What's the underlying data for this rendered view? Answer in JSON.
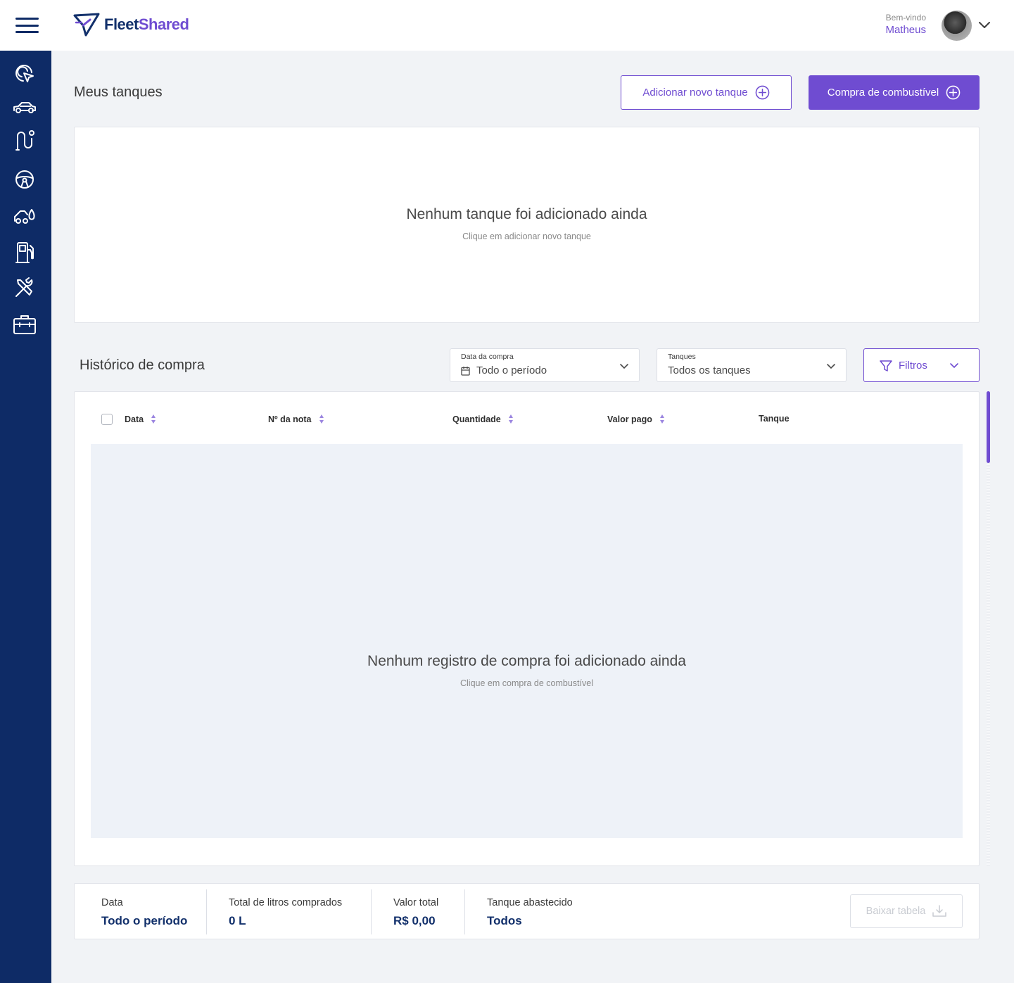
{
  "header": {
    "logo_fleet": "Fleet",
    "logo_shared": "Shared",
    "welcome_label": "Bem-vindo",
    "user_name": "Matheus"
  },
  "sidebar": {
    "items": [
      {
        "icon": "cursor-target-icon"
      },
      {
        "icon": "car-icon"
      },
      {
        "icon": "route-icon"
      },
      {
        "icon": "steering-wheel-icon"
      },
      {
        "icon": "car-fuel-drop-icon"
      },
      {
        "icon": "fuel-pump-icon"
      },
      {
        "icon": "tools-icon"
      },
      {
        "icon": "briefcase-icon"
      }
    ]
  },
  "tanks": {
    "title": "Meus tanques",
    "add_button": "Adicionar novo tanque",
    "purchase_button": "Compra de combustível",
    "empty_title": "Nenhum tanque foi adicionado ainda",
    "empty_subtitle": "Clique em adicionar novo tanque"
  },
  "history": {
    "title": "Histórico de compra",
    "date_filter": {
      "label": "Data da compra",
      "value": "Todo o período"
    },
    "tank_filter": {
      "label": "Tanques",
      "value": "Todos os tanques"
    },
    "filters_button": "Filtros",
    "columns": [
      "Data",
      "Nº da nota",
      "Quantidade",
      "Valor pago",
      "Tanque"
    ],
    "empty_title": "Nenhum registro de compra foi adicionado ainda",
    "empty_subtitle": "Clique em compra de combustível"
  },
  "summary": {
    "date": {
      "label": "Data",
      "value": "Todo o período"
    },
    "liters": {
      "label": "Total de litros comprados",
      "value": "0 L"
    },
    "total": {
      "label": "Valor total",
      "value": "R$ 0,00"
    },
    "tank": {
      "label": "Tanque abastecido",
      "value": "Todos"
    },
    "download_button": "Baixar tabela"
  },
  "colors": {
    "primary": "#6f4cd1",
    "sidebar": "#0e2b66",
    "background": "#f1f3f6"
  }
}
